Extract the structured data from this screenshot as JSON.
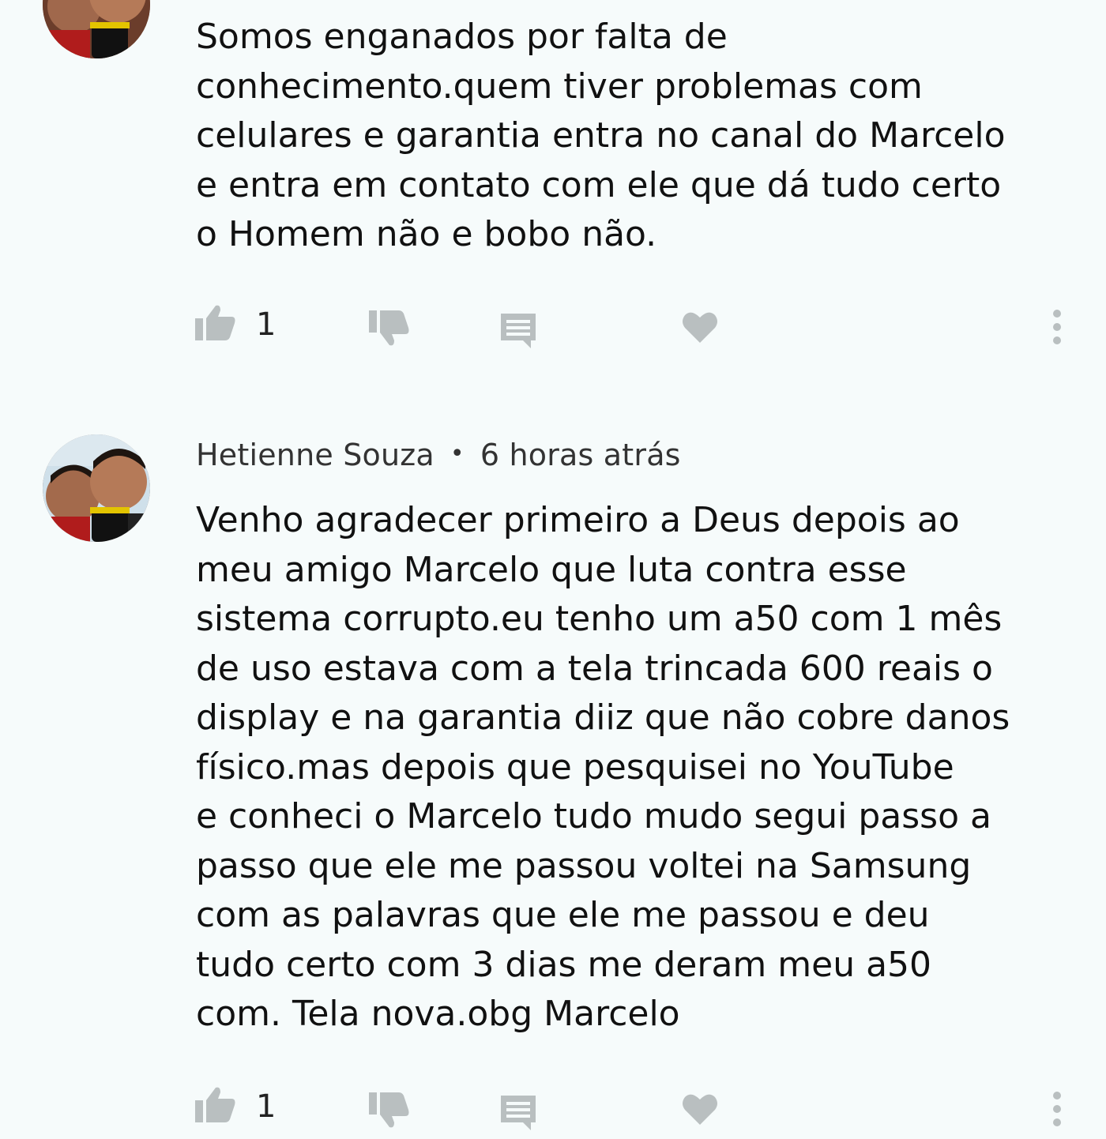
{
  "comments": [
    {
      "author": "",
      "time": "",
      "text": "Somos enganados por falta de\nconhecimento.quem tiver problemas com\ncelulares e garantia entra no canal do Marcelo\ne entra em contato com ele que dá tudo certo\no Homem não e bobo não.",
      "likes": "1"
    },
    {
      "author": "Hetienne Souza",
      "separator": "•",
      "time": "6 horas atrás",
      "text": "Venho agradecer primeiro a Deus depois ao\nmeu amigo Marcelo que luta contra esse\nsistema corrupto.eu tenho um a50 com 1 mês\nde uso estava com a tela trincada  600 reais o\ndisplay e na garantia diiz que não cobre danos\nfísico.mas depois que pesquisei no YouTube\ne conheci o Marcelo tudo mudo segui passo a\npasso que ele me passou voltei na Samsung\ncom as palavras que ele  me passou e deu\ntudo certo com 3 dias me deram meu a50\ncom. Tela nova.obg Marcelo",
      "likes": "1"
    }
  ],
  "icons": {
    "like": "thumb-up-icon",
    "dislike": "thumb-down-icon",
    "reply": "comment-icon",
    "heart": "heart-icon",
    "more": "more-vertical-icon"
  },
  "colors": {
    "background": "#f6fbfb",
    "icon": "#b9bfc0",
    "text": "#111111"
  }
}
